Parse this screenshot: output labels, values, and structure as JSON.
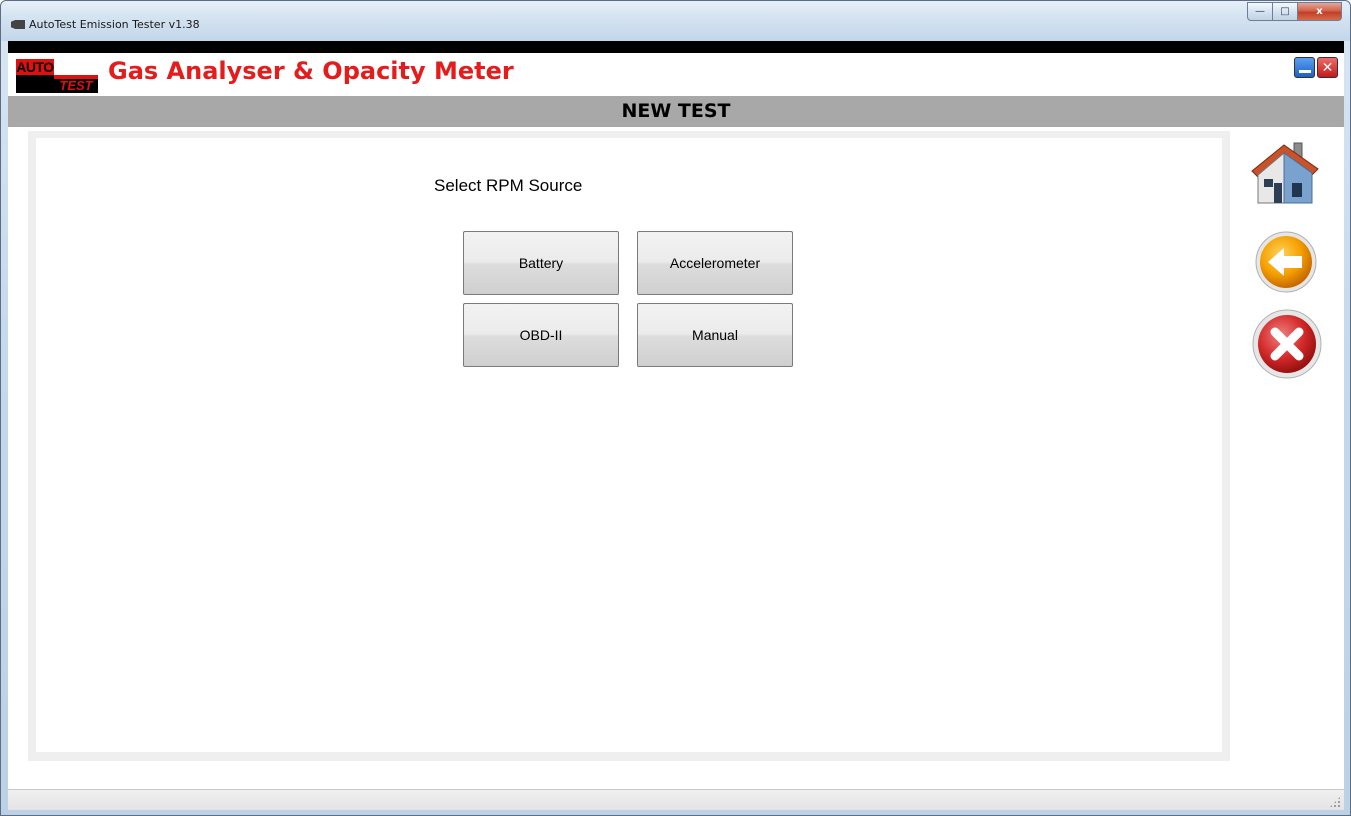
{
  "window": {
    "title": "AutoTest Emission Tester v1.38",
    "controls": {
      "minimize": "—",
      "maximize": "□",
      "close": "x"
    }
  },
  "header": {
    "logo_top": "AUTO",
    "logo_bottom": "TEST",
    "app_title": "Gas Analyser & Opacity Meter",
    "close_glyph": "✕"
  },
  "section": {
    "title": "NEW TEST"
  },
  "main": {
    "prompt": "Select RPM Source",
    "options": [
      "Battery",
      "Accelerometer",
      "OBD-II",
      "Manual"
    ]
  },
  "side_actions": [
    "home-icon",
    "back-arrow-icon",
    "cancel-icon"
  ],
  "colors": {
    "brand_red": "#e41c1c",
    "section_bar": "#a8a8a8",
    "accent_orange": "#f5a000"
  }
}
